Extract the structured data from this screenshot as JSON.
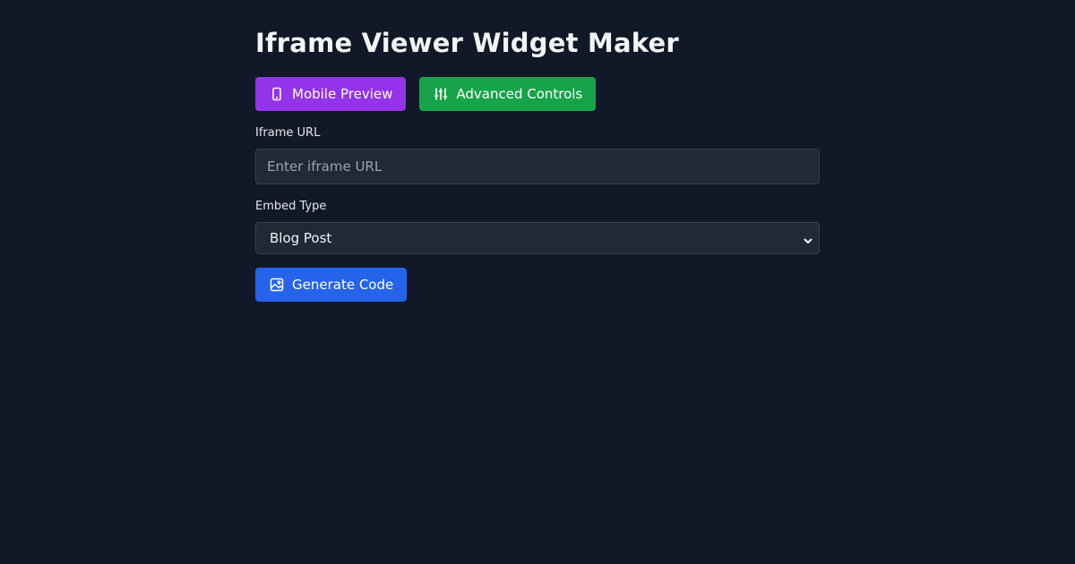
{
  "page": {
    "title": "Iframe Viewer Widget Maker"
  },
  "toolbar": {
    "mobile_preview_label": "Mobile Preview",
    "mobile_preview_icon": "smartphone-icon",
    "advanced_controls_label": "Advanced Controls",
    "advanced_controls_icon": "sliders-icon"
  },
  "form": {
    "url_label": "Iframe URL",
    "url_value": "",
    "url_placeholder": "Enter iframe URL",
    "embed_label": "Embed Type",
    "embed_selected": "Blog Post",
    "generate_label": "Generate Code",
    "generate_icon": "image-icon"
  },
  "colors": {
    "background": "#111827",
    "purple_button": "#9333ea",
    "green_button": "#16a34a",
    "blue_button": "#2563eb",
    "input_background": "#1f2937"
  }
}
